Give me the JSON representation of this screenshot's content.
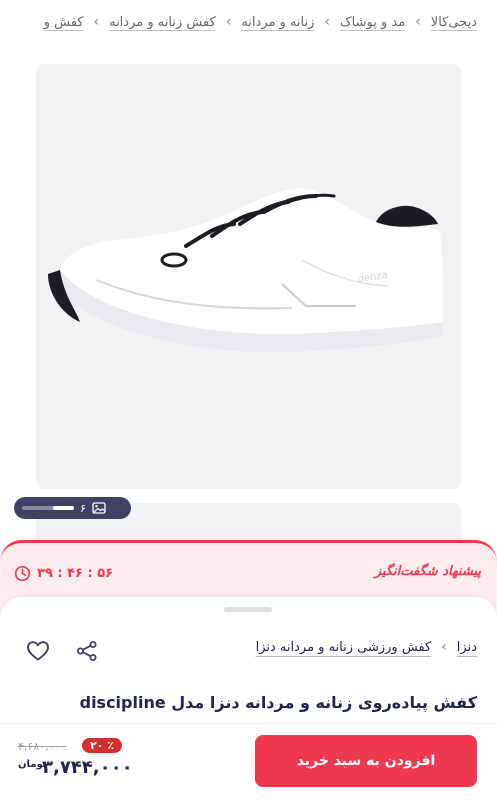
{
  "breadcrumb": [
    "دیجی‌کالا",
    "مد و پوشاک",
    "زنانه و مردانه",
    "کفش زنانه و مردانه",
    "کفش و"
  ],
  "breadcrumb_separator": "›",
  "gallery": {
    "image_count": "۶"
  },
  "offer": {
    "title": "پیشنهاد شگفت‌انگیز",
    "timer": "۳۹ : ۴۶ : ۵۶",
    "color": "#ef394e"
  },
  "brand_row": {
    "brand": "دنزا",
    "category": "کفش ورزشی زنانه و مردانه دنزا"
  },
  "product": {
    "title": "کفش پیاده‌روی زنانه و مردانه دنزا مدل discipline"
  },
  "buy": {
    "button_label": "افزودن به سبد خرید",
    "old_price": "۴,۶۸۰,۰۰۰",
    "discount": "۲۰ ٪",
    "price": "۳,۷۴۴,۰۰۰",
    "currency": "تومان"
  },
  "icons": [
    "image-icon",
    "clock-icon",
    "heart-icon",
    "share-icon"
  ],
  "colors": {
    "accent": "#ef394e",
    "text": "#23254e",
    "offer_bg": "#fdecef"
  }
}
